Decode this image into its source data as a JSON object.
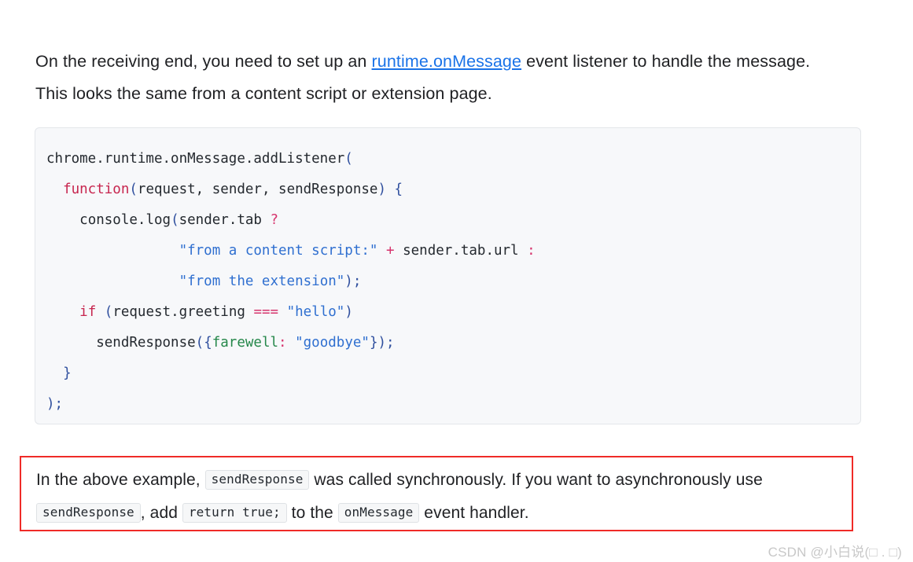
{
  "intro": {
    "before_link": "On the receiving end, you need to set up an ",
    "link_text": "runtime.onMessage",
    "after_link": " event listener to handle the message. This looks the same from a content script or extension page."
  },
  "code_block": {
    "language": "javascript",
    "background_color": "#f7f8fa",
    "border_color": "#e3e6ea",
    "lines": [
      "chrome.runtime.onMessage.addListener(",
      "  function(request, sender, sendResponse) {",
      "    console.log(sender.tab ?",
      "                \"from a content script:\" + sender.tab.url :",
      "                \"from the extension\");",
      "    if (request.greeting === \"hello\")",
      "      sendResponse({farewell: \"goodbye\"});",
      "  }",
      ");"
    ],
    "tokens": {
      "line1": {
        "text": "chrome.runtime.onMessage.addListener",
        "paren": "("
      },
      "line2": {
        "keyword": "function",
        "open": "(",
        "params": "request, sender, sendResponse",
        "close": ")",
        "brace": " {"
      },
      "line3": {
        "text": "console.log",
        "open": "(",
        "expr": "sender.tab ",
        "op": "?"
      },
      "line4": {
        "string": "\"from a content script:\"",
        "op": "+",
        "expr": " sender.tab.url ",
        "colon": ":"
      },
      "line5": {
        "string": "\"from the extension\"",
        "close": ");"
      },
      "line6": {
        "keyword": "if",
        "open": " (",
        "expr": "request.greeting ",
        "op": "===",
        "string": " \"hello\"",
        "close": ")"
      },
      "line7": {
        "text": "sendResponse",
        "open": "({",
        "prop": "farewell",
        "colon": ":",
        "string": " \"goodbye\"",
        "close": "});"
      },
      "line8": {
        "brace": "}"
      },
      "line9": {
        "close": ");"
      }
    },
    "colors": {
      "keyword": "#c7254e",
      "operator": "#d6336c",
      "string": "#2f6fd0",
      "punctuation": "#2f4f9e",
      "property": "#25874a",
      "plain": "#24292f"
    }
  },
  "note": {
    "border_color": "#ef2b27",
    "seg1": "In the above example, ",
    "chip1": "sendResponse",
    "seg2": " was called synchronously. If you want to asynchronously use ",
    "chip2": "sendResponse",
    "seg3": ", add ",
    "chip3": "return true;",
    "seg4": " to the ",
    "chip4": "onMessage",
    "seg5": " event handler."
  },
  "watermark": {
    "text": "CSDN @小白说(□ . □)"
  },
  "link_color": "#1a73e8"
}
